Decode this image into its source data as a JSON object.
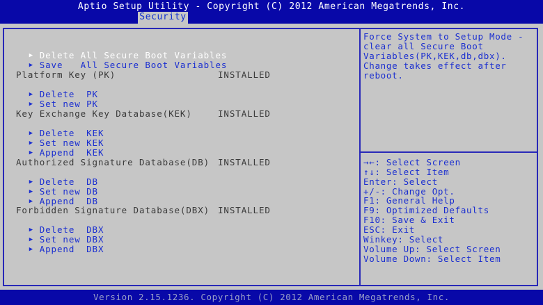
{
  "header": {
    "title": "Aptio Setup Utility - Copyright (C) 2012 American Megatrends, Inc.",
    "active_tab": "Security"
  },
  "menu": {
    "delete_all": "Delete All Secure Boot Variables",
    "save_all": "Save   All Secure Boot Variables",
    "pk": {
      "label": "Platform Key (PK)",
      "status": "INSTALLED",
      "delete": "Delete  PK",
      "set_new": "Set new PK"
    },
    "kek": {
      "label": "Key Exchange Key Database(KEK)",
      "status": "INSTALLED",
      "delete": "Delete  KEK",
      "set_new": "Set new KEK",
      "append": "Append  KEK"
    },
    "db": {
      "label": "Authorized Signature Database(DB)",
      "status": "INSTALLED",
      "delete": "Delete  DB",
      "set_new": "Set new DB",
      "append": "Append  DB"
    },
    "dbx": {
      "label": "Forbidden Signature Database(DBX)",
      "status": "INSTALLED",
      "delete": "Delete  DBX",
      "set_new": "Set new DBX",
      "append": "Append  DBX"
    }
  },
  "help": {
    "lines": [
      "Force System to Setup Mode -",
      "clear all Secure Boot",
      "Variables(PK,KEK,db,dbx).",
      "Change takes effect after",
      "reboot."
    ]
  },
  "keys": {
    "lines": [
      "→←: Select Screen",
      "↑↓: Select Item",
      "Enter: Select",
      "+/-: Change Opt.",
      "F1: General Help",
      "F9: Optimized Defaults",
      "F10: Save & Exit",
      "ESC: Exit",
      "Winkey: Select",
      "Volume Up: Select Screen",
      "Volume Down: Select Item"
    ]
  },
  "footer": {
    "text": "Version 2.15.1236. Copyright (C) 2012 American Megatrends, Inc."
  },
  "icons": {
    "submenu_arrow": "▶"
  },
  "colors": {
    "header_bg": "#0808a8",
    "body_bg": "#c6c6c6",
    "item_text": "#1a2ed0",
    "label_text": "#3a3a3a",
    "selected_text": "#ffffff"
  }
}
